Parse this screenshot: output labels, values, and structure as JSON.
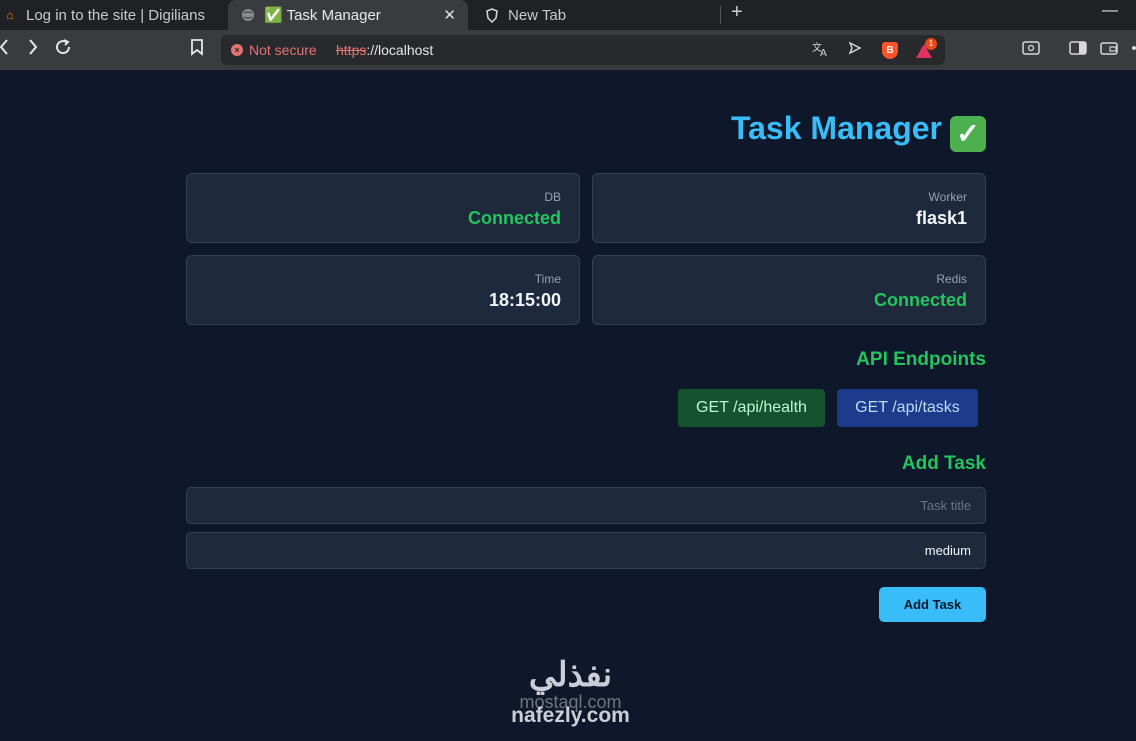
{
  "browser": {
    "tabs": [
      {
        "title": "Log in to the site | Digilians",
        "favicon": "moodle-icon"
      },
      {
        "title": "✅ Task Manager",
        "favicon": "globe-icon",
        "active": true
      },
      {
        "title": "New Tab",
        "favicon": "brave-shield-icon"
      }
    ],
    "new_tab_glyph": "+",
    "close_glyph": "✕",
    "minimize_glyph": "—",
    "security_label": "Not secure",
    "url_scheme": "https",
    "url_rest": "://localhost",
    "rewards_badge": "1"
  },
  "app": {
    "title": "Task Manager",
    "title_emoji": "✓",
    "status_cards": [
      {
        "label": "DB",
        "value": "Connected",
        "status": "ok"
      },
      {
        "label": "Worker",
        "value": "flask1",
        "status": "plain"
      },
      {
        "label": "Time",
        "value": "18:15:00",
        "status": "plain"
      },
      {
        "label": "Redis",
        "value": "Connected",
        "status": "ok"
      }
    ],
    "endpoints_heading": "API Endpoints",
    "endpoints": [
      {
        "label": "GET /api/health"
      },
      {
        "label": "GET /api/tasks"
      }
    ],
    "add_task_heading": "Add Task",
    "task_title_placeholder": "Task title",
    "task_title_value": "",
    "priority_value": "medium",
    "add_button_label": "Add Task"
  },
  "watermark": {
    "logo_text": "نفذلي",
    "line1": "mostaql.com",
    "line2": "nafezly.com"
  },
  "colors": {
    "page_bg": "#0f172a",
    "card_bg": "#1e293b",
    "accent_blue": "#38bdf8",
    "success_green": "#22c55e"
  }
}
